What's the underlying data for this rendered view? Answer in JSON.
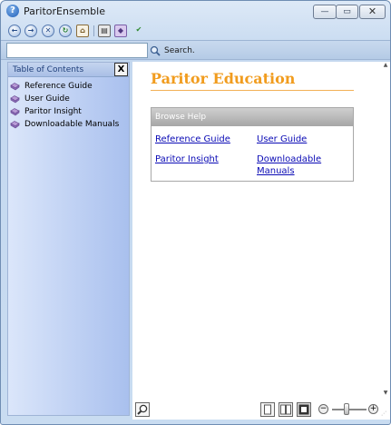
{
  "window": {
    "title": "ParitorEnsemble",
    "app_icon_glyph": "?"
  },
  "window_controls": {
    "minimize": "—",
    "maximize": "▭",
    "close": "✕"
  },
  "toolbar": {
    "icons": [
      "back-icon",
      "forward-icon",
      "stop-icon",
      "refresh-icon",
      "home-icon",
      "print-icon",
      "options-icon",
      "bookmark-icon"
    ]
  },
  "search": {
    "value": "",
    "placeholder": "",
    "button_label": "Search."
  },
  "toc": {
    "title": "Table of Contents",
    "close_label": "X",
    "items": [
      {
        "label": "Reference Guide"
      },
      {
        "label": "User Guide"
      },
      {
        "label": "Paritor Insight"
      },
      {
        "label": "Downloadable Manuals"
      }
    ]
  },
  "content": {
    "title": "Paritor Education",
    "browse": {
      "header": "Browse Help",
      "links": [
        {
          "label": "Reference Guide"
        },
        {
          "label": "User Guide"
        },
        {
          "label": "Paritor Insight"
        },
        {
          "label": "Downloadable Manuals"
        }
      ]
    }
  },
  "zoom": {
    "out_label": "−",
    "in_label": "+"
  },
  "colors": {
    "title_accent": "#f19c1e",
    "link": "#0a0ab5",
    "toc_gradient_end": "#a9c0ee"
  }
}
